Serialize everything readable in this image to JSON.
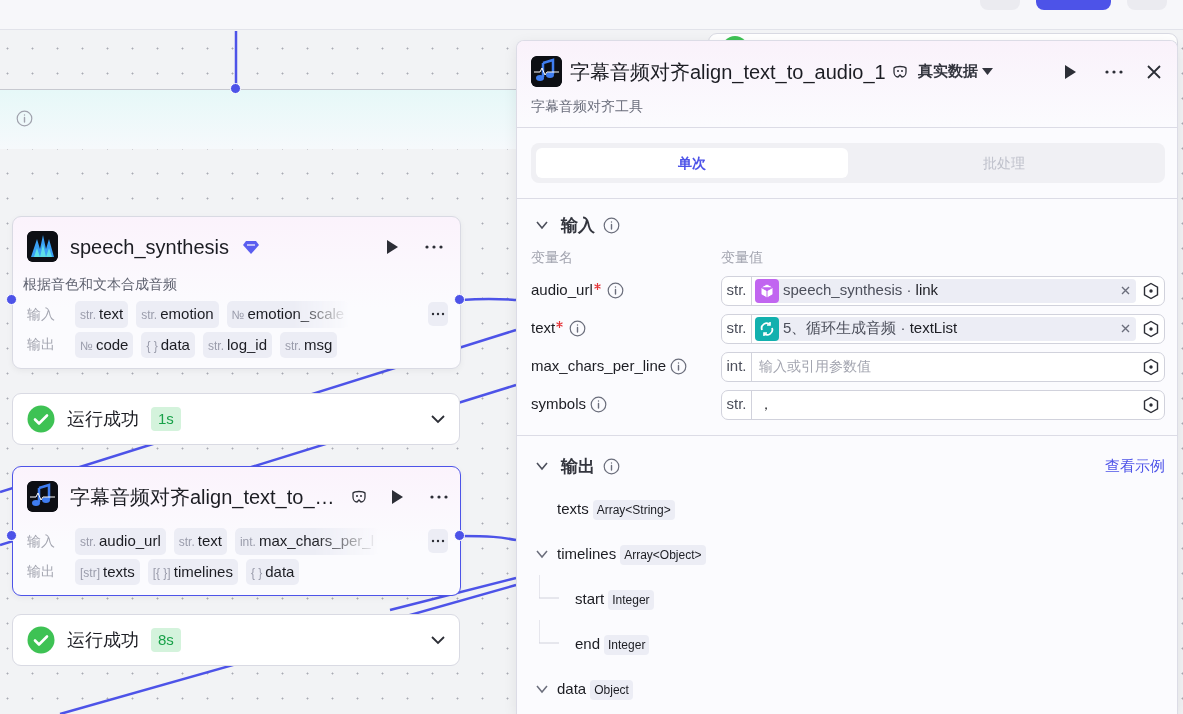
{
  "canvas_nodes": [
    {
      "kind": "speech",
      "title": "speech_synthesis",
      "selected": false,
      "description": "根据音色和文本合成音频",
      "inputs_label": "输入",
      "inputs": [
        {
          "type": "str.",
          "name": "text"
        },
        {
          "type": "str.",
          "name": "emotion"
        },
        {
          "type": "№",
          "name": "emotion_scale"
        }
      ],
      "outputs_label": "输出",
      "outputs": [
        {
          "type": "№",
          "name": "code"
        },
        {
          "type": "{ }",
          "name": "data"
        },
        {
          "type": "str.",
          "name": "log_id"
        },
        {
          "type": "str.",
          "name": "msg"
        }
      ],
      "status": {
        "text": "运行成功",
        "duration": "1s"
      }
    },
    {
      "kind": "align",
      "title": "字幕音频对齐align_text_to_…",
      "selected": true,
      "inputs_label": "输入",
      "inputs": [
        {
          "type": "str.",
          "name": "audio_url"
        },
        {
          "type": "str.",
          "name": "text"
        },
        {
          "type": "int.",
          "name": "max_chars_per_l"
        }
      ],
      "outputs_label": "输出",
      "outputs": [
        {
          "type": "[str]",
          "name": "texts"
        },
        {
          "type": "[{ }]",
          "name": "timelines"
        },
        {
          "type": "{ }",
          "name": "data"
        }
      ],
      "status": {
        "text": "运行成功",
        "duration": "8s"
      }
    }
  ],
  "panel": {
    "title": "字幕音频对齐align_text_to_audio_1",
    "data_mode": "真实数据",
    "description": "字幕音频对齐工具",
    "tabs": [
      {
        "label": "单次",
        "selected": true
      },
      {
        "label": "批处理",
        "selected": false
      }
    ],
    "input_section": {
      "title": "输入",
      "expanded": true,
      "name_header": "变量名",
      "value_header": "变量值",
      "params": [
        {
          "name": "audio_url",
          "required": true,
          "type": "str.",
          "ref": {
            "kind": "node",
            "text": "speech_synthesis · **link**"
          }
        },
        {
          "name": "text",
          "required": true,
          "type": "str.",
          "ref": {
            "kind": "loop",
            "text": "5、循环生成音频 · **textList**"
          }
        },
        {
          "name": "max_chars_per_line",
          "required": false,
          "type": "int.",
          "placeholder": "输入或引用参数值"
        },
        {
          "name": "symbols",
          "required": false,
          "type": "str.",
          "value": "，"
        }
      ]
    },
    "output_section": {
      "title": "输出",
      "expanded": true,
      "example_link": "查看示例",
      "fields": [
        {
          "kind": "leaf",
          "name": "texts",
          "type": "Array<String>"
        },
        {
          "kind": "group",
          "name": "timelines",
          "type": "Array<Object>",
          "expanded": true,
          "children": [
            {
              "kind": "leaf",
              "name": "start",
              "type": "Integer"
            },
            {
              "kind": "leaf",
              "name": "end",
              "type": "Integer"
            }
          ]
        },
        {
          "kind": "group",
          "name": "data",
          "type": "Object",
          "expanded": true
        }
      ]
    }
  }
}
